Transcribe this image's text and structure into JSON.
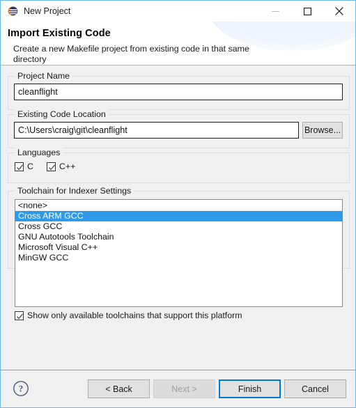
{
  "window": {
    "title": "New Project",
    "app_icon": "eclipse-sphere-icon",
    "border_color": "#6cb8e8",
    "caption": {
      "minimize": "minimize-icon",
      "maximize": "maximize-icon",
      "close": "close-icon"
    }
  },
  "header": {
    "title": "Import Existing Code",
    "description": "Create a new Makefile project from existing code in that same directory"
  },
  "project_name": {
    "group_label": "Project Name",
    "value": "cleanflight",
    "placeholder": ""
  },
  "existing_code_location": {
    "group_label": "Existing Code Location",
    "value": "C:\\Users\\craig\\git\\cleanflight",
    "placeholder": "",
    "browse_label": "Browse..."
  },
  "languages": {
    "group_label": "Languages",
    "options": [
      {
        "label": "C",
        "checked": true
      },
      {
        "label": "C++",
        "checked": true
      }
    ]
  },
  "toolchain": {
    "group_label": "Toolchain for Indexer Settings",
    "items": [
      {
        "label": "<none>",
        "selected": false
      },
      {
        "label": "Cross ARM GCC",
        "selected": true
      },
      {
        "label": "Cross GCC",
        "selected": false
      },
      {
        "label": "GNU Autotools Toolchain",
        "selected": false
      },
      {
        "label": "Microsoft Visual C++",
        "selected": false
      },
      {
        "label": "MinGW GCC",
        "selected": false
      }
    ],
    "selection_color": "#2f9ae8",
    "show_only_available": {
      "label": "Show only available toolchains that support this platform",
      "checked": true
    }
  },
  "footer": {
    "help_icon": "help-circle-icon",
    "buttons": [
      {
        "label": "< Back",
        "state": "enabled"
      },
      {
        "label": "Next >",
        "state": "disabled"
      },
      {
        "label": "Finish",
        "state": "default"
      },
      {
        "label": "Cancel",
        "state": "enabled"
      }
    ]
  }
}
